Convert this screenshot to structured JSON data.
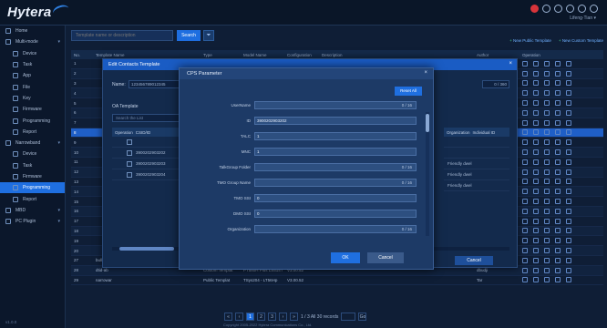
{
  "app": {
    "logo": "Hytera",
    "user": "Lifeng·Tian ▾"
  },
  "sidebar": {
    "items": [
      {
        "label": "Home",
        "level": 0,
        "icon": "home-icon"
      },
      {
        "label": "Multi-mode",
        "level": 0,
        "icon": "grid-icon",
        "caret": "▾"
      },
      {
        "label": "Device",
        "level": 1,
        "icon": "device-icon"
      },
      {
        "label": "Task",
        "level": 1,
        "icon": "task-icon"
      },
      {
        "label": "App",
        "level": 1,
        "icon": "app-icon"
      },
      {
        "label": "File",
        "level": 1,
        "icon": "file-icon"
      },
      {
        "label": "Key",
        "level": 1,
        "icon": "key-icon"
      },
      {
        "label": "Firmware",
        "level": 1,
        "icon": "firmware-icon"
      },
      {
        "label": "Programming",
        "level": 1,
        "icon": "programming-icon"
      },
      {
        "label": "Report",
        "level": 1,
        "icon": "report-icon"
      },
      {
        "label": "Narrowband",
        "level": 0,
        "icon": "radio-icon",
        "caret": "▾"
      },
      {
        "label": "Device",
        "level": 1,
        "icon": "device-icon"
      },
      {
        "label": "Task",
        "level": 1,
        "icon": "task-icon"
      },
      {
        "label": "Firmware",
        "level": 1,
        "icon": "firmware-icon"
      },
      {
        "label": "Programming",
        "level": 1,
        "icon": "programming-icon",
        "active": true
      },
      {
        "label": "Report",
        "level": 1,
        "icon": "report-icon"
      },
      {
        "label": "MBD",
        "level": 0,
        "icon": "mbd-icon",
        "caret": "▾"
      },
      {
        "label": "PC Plugin",
        "level": 0,
        "icon": "plugin-icon",
        "caret": "▾"
      }
    ],
    "footer": "v1.0.0"
  },
  "toolbar": {
    "search_placeholder": "Template name or description",
    "search_label": "Search",
    "filter_icon": "filter-icon",
    "add_public": "New Public Template",
    "add_custom": "New Custom Template"
  },
  "table": {
    "headers": {
      "no": "No.",
      "name": "Template Name",
      "type": "Type",
      "model": "Model Name",
      "conf": "Configuration",
      "desc": "Description",
      "author": "Author",
      "ops": "Operation"
    },
    "rows": [
      {
        "no": "1",
        "name": "",
        "type": "",
        "model": "",
        "conf": "",
        "desc": "",
        "author": ""
      },
      {
        "no": "2",
        "name": "",
        "type": "",
        "model": "",
        "conf": "",
        "desc": "",
        "author": ""
      },
      {
        "no": "3",
        "name": "",
        "type": "",
        "model": "",
        "conf": "",
        "desc": "",
        "author": ""
      },
      {
        "no": "4",
        "name": "",
        "type": "",
        "model": "",
        "conf": "",
        "desc": "",
        "author": ""
      },
      {
        "no": "5",
        "name": "",
        "type": "",
        "model": "",
        "conf": "",
        "desc": "",
        "author": ""
      },
      {
        "no": "6",
        "name": "",
        "type": "",
        "model": "",
        "conf": "",
        "desc": "",
        "author": ""
      },
      {
        "no": "7",
        "name": "",
        "type": "",
        "model": "",
        "conf": "",
        "desc": "",
        "author": ""
      },
      {
        "no": "8",
        "name": "",
        "type": "",
        "model": "",
        "conf": "",
        "desc": "",
        "author": "",
        "selected": true
      },
      {
        "no": "9",
        "name": "",
        "type": "",
        "model": "",
        "conf": "",
        "desc": "",
        "author": ""
      },
      {
        "no": "10",
        "name": "",
        "type": "",
        "model": "",
        "conf": "",
        "desc": "",
        "author": ""
      },
      {
        "no": "11",
        "name": "",
        "type": "",
        "model": "",
        "conf": "",
        "desc": "",
        "author": ""
      },
      {
        "no": "12",
        "name": "",
        "type": "",
        "model": "",
        "conf": "",
        "desc": "",
        "author": ""
      },
      {
        "no": "13",
        "name": "",
        "type": "",
        "model": "",
        "conf": "",
        "desc": "",
        "author": ""
      },
      {
        "no": "14",
        "name": "",
        "type": "",
        "model": "",
        "conf": "",
        "desc": "",
        "author": ""
      },
      {
        "no": "15",
        "name": "",
        "type": "",
        "model": "",
        "conf": "",
        "desc": "",
        "author": ""
      },
      {
        "no": "16",
        "name": "",
        "type": "",
        "model": "",
        "conf": "",
        "desc": "",
        "author": ""
      },
      {
        "no": "17",
        "name": "",
        "type": "",
        "model": "",
        "conf": "",
        "desc": "",
        "author": ""
      },
      {
        "no": "18",
        "name": "",
        "type": "",
        "model": "",
        "conf": "",
        "desc": "",
        "author": ""
      },
      {
        "no": "19",
        "name": "",
        "type": "",
        "model": "",
        "conf": "",
        "desc": "",
        "author": ""
      },
      {
        "no": "20",
        "name": "",
        "type": "",
        "model": "",
        "conf": "",
        "desc": "",
        "author": ""
      },
      {
        "no": "27",
        "name": "bulletin-dch",
        "type": "Custom Templat",
        "model": "PT580H Plus LS514T",
        "conf": "V3.00.52",
        "desc": "",
        "author": "djaraz"
      },
      {
        "no": "28",
        "name": "dtid-ab",
        "type": "Custom Templat",
        "model": "PT580H Plus LS514T",
        "conf": "V3.00.52",
        "desc": "",
        "author": "dbudji"
      },
      {
        "no": "29",
        "name": "narrowar",
        "type": "Public Templat",
        "model": "TSys204 - LT56Hp",
        "conf": "V3.00.52",
        "desc": "",
        "author": "Tar"
      }
    ]
  },
  "pager": {
    "prev": "«",
    "first": "‹",
    "pages": [
      "1",
      "2",
      "3"
    ],
    "current": "1",
    "next": "›",
    "last": "»",
    "summary": "1 / 3  All 30 records",
    "jump_label": "Go"
  },
  "copyright": "Copyright 2005-2022 Hytera Communications Co., Ltd.",
  "edit_dialog": {
    "title": "Edit Contacts Template",
    "close": "×",
    "name_label": "Name:",
    "name_value": "123456789012345",
    "sub_label": "OA Template",
    "search_placeholder": "Search the List",
    "right_value": "0 / 360",
    "inner_headers": {
      "op": "Operation",
      "id": "CSID/ID"
    },
    "inner_rows": [
      "",
      "3900202903202",
      "3900202903203",
      "3900202903204"
    ],
    "right_headers": {
      "org": "Organization",
      "individual": "Individual ID"
    },
    "right_rows": [
      "",
      "",
      "Friendly dwel",
      "Friendly dwel",
      "Friendly dwel"
    ],
    "cancel": "Cancel"
  },
  "cps_dialog": {
    "title": "CPS Parameter",
    "close": "×",
    "reset": "Reset All",
    "fields": [
      {
        "label": "UserName",
        "value": "",
        "counter": "0 / 16"
      },
      {
        "label": "ID",
        "value": "3900202903202",
        "counter": ""
      },
      {
        "label": "TALC",
        "value": "1",
        "counter": ""
      },
      {
        "label": "MNC",
        "value": "1",
        "counter": ""
      },
      {
        "label": "TalkGroup Folder",
        "value": "",
        "counter": "0 / 16"
      },
      {
        "label": "TMO Group Name",
        "value": "",
        "counter": "0 / 16"
      },
      {
        "label": "TMO SSI",
        "value": "0",
        "counter": ""
      },
      {
        "label": "DMO SSI",
        "value": "0",
        "counter": ""
      },
      {
        "label": "Organization",
        "value": "",
        "counter": "0 / 16"
      }
    ],
    "ok": "OK",
    "cancel": "Cancel"
  }
}
